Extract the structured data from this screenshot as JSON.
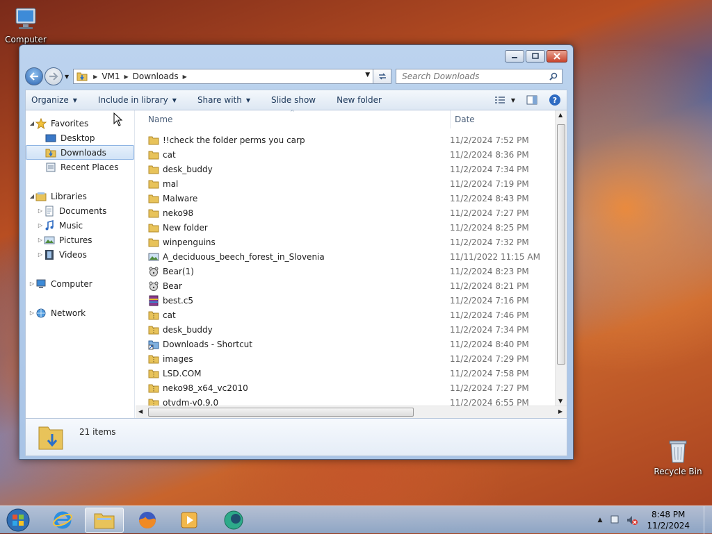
{
  "desktop": {
    "icons": [
      {
        "label": "Computer"
      },
      {
        "label": "Recycle Bin"
      }
    ]
  },
  "window": {
    "address": {
      "crumbs": [
        "VM1",
        "Downloads"
      ]
    },
    "search": {
      "placeholder": "Search Downloads"
    },
    "toolbar": {
      "organize": "Organize",
      "include_in_library": "Include in library",
      "share_with": "Share with",
      "slide_show": "Slide show",
      "new_folder": "New folder"
    },
    "nav": {
      "favorites": "Favorites",
      "desktop": "Desktop",
      "downloads": "Downloads",
      "recent_places": "Recent Places",
      "libraries": "Libraries",
      "documents": "Documents",
      "music": "Music",
      "pictures": "Pictures",
      "videos": "Videos",
      "computer": "Computer",
      "network": "Network"
    },
    "columns": {
      "name": "Name",
      "date": "Date"
    },
    "files": [
      {
        "name": "!!check the folder perms you carp",
        "date": "11/2/2024 7:52 PM",
        "icon": "folder-icon"
      },
      {
        "name": "cat",
        "date": "11/2/2024 8:36 PM",
        "icon": "folder-icon"
      },
      {
        "name": "desk_buddy",
        "date": "11/2/2024 7:34 PM",
        "icon": "folder-icon"
      },
      {
        "name": "mal",
        "date": "11/2/2024 7:19 PM",
        "icon": "folder-icon"
      },
      {
        "name": "Malware",
        "date": "11/2/2024 8:43 PM",
        "icon": "folder-icon"
      },
      {
        "name": "neko98",
        "date": "11/2/2024 7:27 PM",
        "icon": "folder-icon"
      },
      {
        "name": "New folder",
        "date": "11/2/2024 8:25 PM",
        "icon": "folder-icon"
      },
      {
        "name": "winpenguins",
        "date": "11/2/2024 7:32 PM",
        "icon": "folder-icon"
      },
      {
        "name": "A_deciduous_beech_forest_in_Slovenia",
        "date": "11/11/2022 11:15 AM",
        "icon": "image-file-icon"
      },
      {
        "name": "Bear(1)",
        "date": "11/2/2024 8:23 PM",
        "icon": "bear-app-icon"
      },
      {
        "name": "Bear",
        "date": "11/2/2024 8:21 PM",
        "icon": "bear-app-icon"
      },
      {
        "name": "best.c5",
        "date": "11/2/2024 7:16 PM",
        "icon": "archive-icon"
      },
      {
        "name": "cat",
        "date": "11/2/2024 7:46 PM",
        "icon": "zip-folder-icon"
      },
      {
        "name": "desk_buddy",
        "date": "11/2/2024 7:34 PM",
        "icon": "zip-folder-icon"
      },
      {
        "name": "Downloads - Shortcut",
        "date": "11/2/2024 8:40 PM",
        "icon": "shortcut-icon"
      },
      {
        "name": "images",
        "date": "11/2/2024 7:29 PM",
        "icon": "zip-folder-icon"
      },
      {
        "name": "LSD.COM",
        "date": "11/2/2024 7:58 PM",
        "icon": "zip-folder-icon"
      },
      {
        "name": "neko98_x64_vc2010",
        "date": "11/2/2024 7:27 PM",
        "icon": "zip-folder-icon"
      },
      {
        "name": "otvdm-v0.9.0",
        "date": "11/2/2024 6:55 PM",
        "icon": "zip-folder-icon"
      }
    ],
    "status": {
      "count": "21 items"
    }
  },
  "taskbar": {
    "clock_time": "8:48 PM",
    "clock_date": "11/2/2024"
  },
  "colors": {
    "accent": "#3c7fb1",
    "folder": "#e8c35a",
    "close_button": "#c8452d"
  }
}
